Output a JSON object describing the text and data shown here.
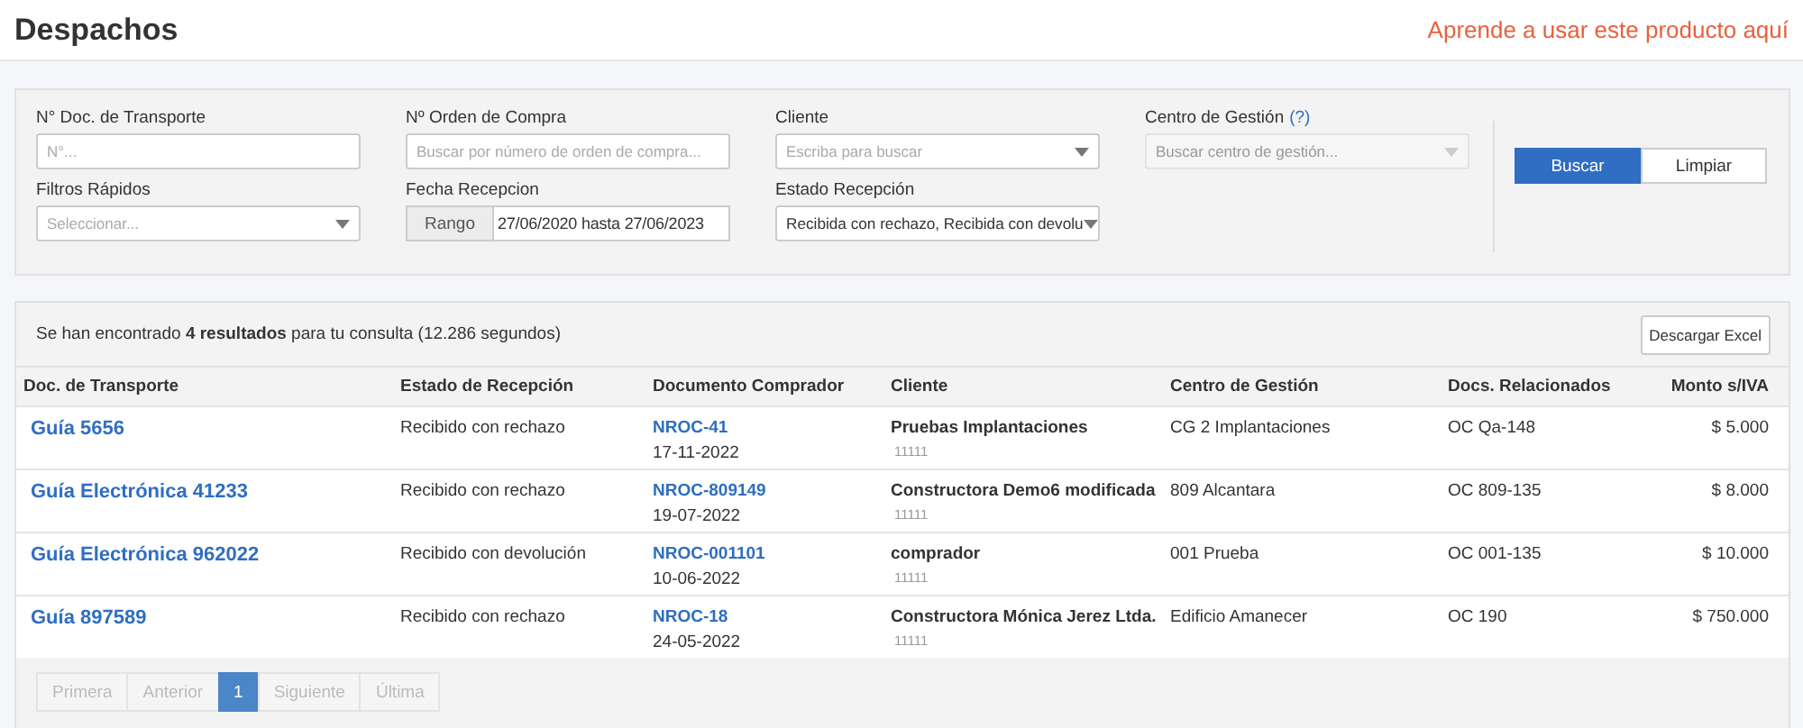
{
  "header": {
    "title": "Despachos",
    "help_link": "Aprende a usar este producto aquí"
  },
  "filters": [
    {
      "kind": "text",
      "label": "N° Doc. de Transporte",
      "placeholder": "N°...",
      "disabled": false
    },
    {
      "kind": "text",
      "label": "Nº Orden de Compra",
      "placeholder": "Buscar por número de orden de compra...",
      "disabled": false
    },
    {
      "kind": "select",
      "label": "Cliente",
      "placeholder": "Escriba para buscar",
      "disabled": false
    },
    {
      "kind": "select",
      "label": "Centro de Gestión",
      "help": "(?)",
      "placeholder": "Buscar centro de gestión...",
      "disabled": true
    },
    {
      "kind": "select",
      "label": "Filtros Rápidos",
      "placeholder": "Seleccionar...",
      "disabled": false
    },
    {
      "kind": "range",
      "label": "Fecha Recepcion",
      "addon": "Rango",
      "value": "27/06/2020 hasta 27/06/2023",
      "disabled": false
    },
    {
      "kind": "select",
      "label": "Estado Recepción",
      "value": "Recibida con rechazo, Recibida con devolu",
      "disabled": false
    }
  ],
  "buttons": [
    {
      "label": "Buscar",
      "kind": "primary"
    },
    {
      "label": "Limpiar",
      "kind": "default"
    }
  ],
  "results": {
    "summary": "Se han encontrado **4 resultados** para tu consulta (12.286 segundos)",
    "export_button": "Descargar Excel",
    "columns": [
      "Doc. de Transporte",
      "Estado de Recepción",
      "Documento Comprador",
      "Cliente",
      "Centro de Gestión",
      "Docs. Relacionados",
      "Monto s/IVA"
    ],
    "rows": [
      {
        "document": "Guía 5656",
        "status": "Recibido con rechazo",
        "buyer_doc": "NROC-41",
        "buyer_date": "17-11-2022",
        "client": "Pruebas Implantaciones",
        "client_code": "11111",
        "center": "CG 2 Implantaciones",
        "related": "OC Qa-148",
        "amount": "$ 5.000"
      },
      {
        "document": "Guía Electrónica 41233",
        "status": "Recibido con rechazo",
        "buyer_doc": "NROC-809149",
        "buyer_date": "19-07-2022",
        "client": "Constructora Demo6 modificada",
        "client_code": "11111",
        "center": "809 Alcantara",
        "related": "OC 809-135",
        "amount": "$ 8.000"
      },
      {
        "document": "Guía Electrónica 962022",
        "status": "Recibido con devolución",
        "buyer_doc": "NROC-001101",
        "buyer_date": "10-06-2022",
        "client": "comprador",
        "client_code": "11111",
        "center": "001 Prueba",
        "related": "OC 001-135",
        "amount": "$ 10.000"
      },
      {
        "document": "Guía 897589",
        "status": "Recibido con rechazo",
        "buyer_doc": "NROC-18",
        "buyer_date": "24-05-2022",
        "client": "Constructora Mónica Jerez Ltda.",
        "client_code": "11111",
        "center": "Edificio Amanecer",
        "related": "OC 190",
        "amount": "$ 750.000"
      }
    ],
    "pagination": [
      {
        "label": "Primera",
        "selected": false,
        "disabled": true
      },
      {
        "label": "Anterior",
        "selected": false,
        "disabled": true
      },
      {
        "label": "1",
        "selected": true,
        "disabled": false
      },
      {
        "label": "Siguiente",
        "selected": false,
        "disabled": true
      },
      {
        "label": "Última",
        "selected": false,
        "disabled": true
      }
    ]
  }
}
